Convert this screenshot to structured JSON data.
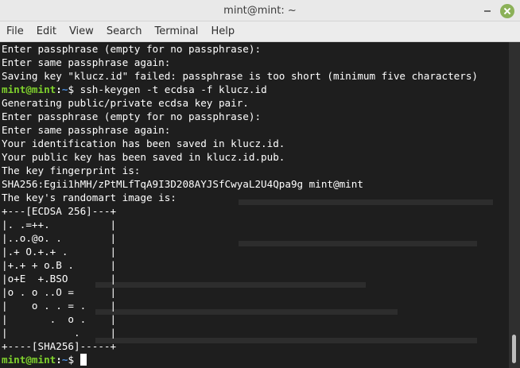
{
  "window": {
    "title": "mint@mint: ~",
    "minimize_icon": "minimize-icon",
    "close_icon": "close-icon",
    "accent_color": "#8bb158"
  },
  "menu": [
    "File",
    "Edit",
    "View",
    "Search",
    "Terminal",
    "Help"
  ],
  "prompt": {
    "user": "mint@mint",
    "sep": ":",
    "path": "~",
    "symbol": "$ "
  },
  "terminal": {
    "lines": [
      {
        "type": "out",
        "text": "Enter passphrase (empty for no passphrase):"
      },
      {
        "type": "out",
        "text": "Enter same passphrase again:"
      },
      {
        "type": "out",
        "text": "Saving key \"klucz.id\" failed: passphrase is too short (minimum five characters)"
      },
      {
        "type": "cmd",
        "text": "ssh-keygen -t ecdsa -f klucz.id"
      },
      {
        "type": "out",
        "text": "Generating public/private ecdsa key pair."
      },
      {
        "type": "out",
        "text": "Enter passphrase (empty for no passphrase):"
      },
      {
        "type": "out",
        "text": "Enter same passphrase again:"
      },
      {
        "type": "out",
        "text": "Your identification has been saved in klucz.id."
      },
      {
        "type": "out",
        "text": "Your public key has been saved in klucz.id.pub."
      },
      {
        "type": "out",
        "text": "The key fingerprint is:"
      },
      {
        "type": "out",
        "text": "SHA256:Egii1hMH/zPtMLfTqA9I3D208AYJSfCwyaL2U4Qpa9g mint@mint"
      },
      {
        "type": "out",
        "text": "The key's randomart image is:"
      },
      {
        "type": "out",
        "text": "+---[ECDSA 256]---+"
      },
      {
        "type": "out",
        "text": "|. .=++.          |"
      },
      {
        "type": "out",
        "text": "|..o.@o. .        |"
      },
      {
        "type": "out",
        "text": "|.+ O.+.+ .       |"
      },
      {
        "type": "out",
        "text": "|+.+ + o.B .      |"
      },
      {
        "type": "out",
        "text": "|o+E  +.BSO       |"
      },
      {
        "type": "out",
        "text": "|o . o ..O =      |"
      },
      {
        "type": "out",
        "text": "|    o . . = .    |"
      },
      {
        "type": "out",
        "text": "|       .  o .    |"
      },
      {
        "type": "out",
        "text": "|           .     |"
      },
      {
        "type": "out",
        "text": "+----[SHA256]-----+"
      },
      {
        "type": "cmd",
        "text": "",
        "cursor": true
      }
    ]
  }
}
